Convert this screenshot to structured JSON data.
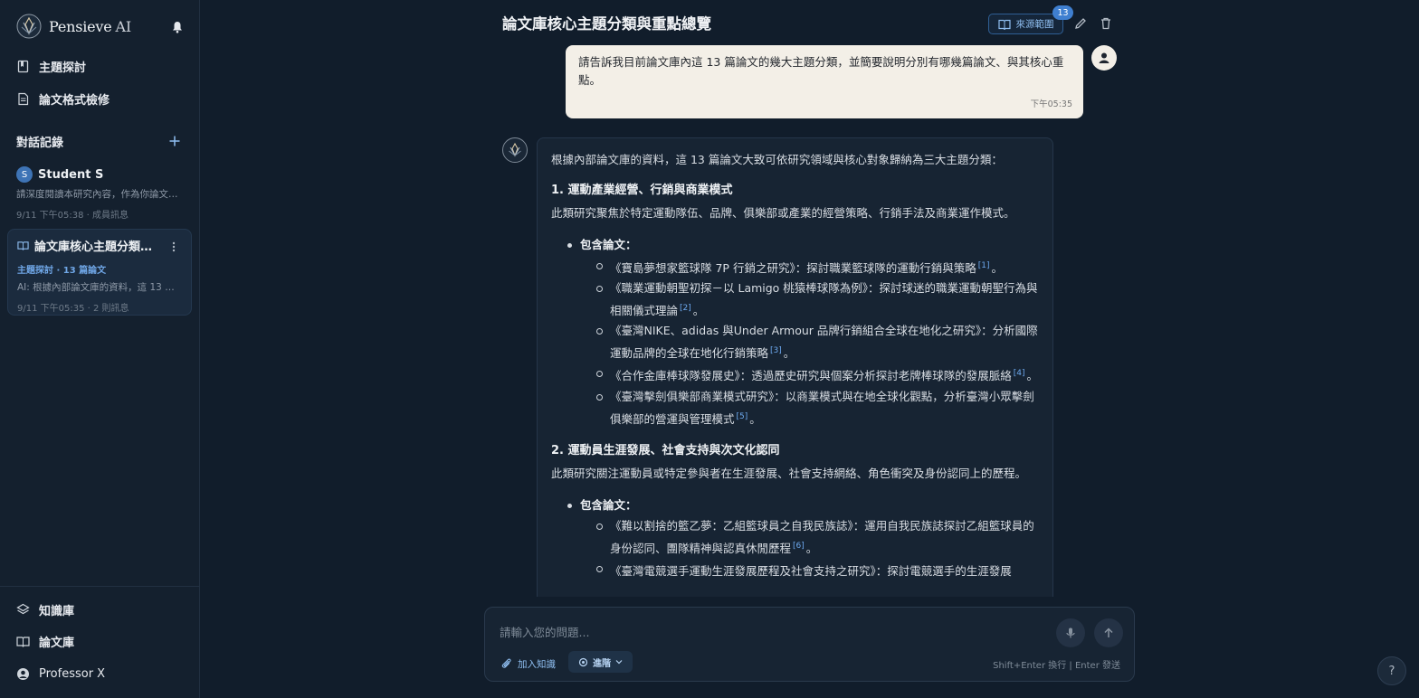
{
  "brand": {
    "name": "Pensieve",
    "suffix": "AI"
  },
  "nav": {
    "topic_explore": "主題探討",
    "format_check": "論文格式檢修",
    "knowledge_base": "知識庫",
    "paper_library": "論文庫",
    "user_name": "Professor X"
  },
  "history": {
    "title": "對話記錄",
    "items": [
      {
        "avatar_letter": "S",
        "name": "Student S",
        "preview": "請深度閱讀本研究內容，作為你論文…",
        "meta": "9/11 下午05:38 · 成員訊息"
      },
      {
        "name": "論文庫核心主題分類與重點總覽",
        "tag": "主題探討 · 13 篇論文",
        "preview": "AI: 根據內部論文庫的資料，這 13 篇…",
        "meta": "9/11 下午05:35 · 2 則訊息"
      }
    ]
  },
  "header": {
    "title": "論文庫核心主題分類與重點總覽",
    "source_label": "來源範圍",
    "source_count": "13"
  },
  "user_message": {
    "text": "請告訴我目前論文庫內這 13 篇論文的幾大主題分類，並簡要說明分別有哪幾篇論文、與其核心重點。",
    "time": "下午05:35"
  },
  "ai_message": {
    "intro": "根據內部論文庫的資料，這 13 篇論文大致可依研究領域與核心對象歸納為三大主題分類：",
    "sections": [
      {
        "heading": "1. 運動產業經營、行銷與商業模式",
        "desc": "此類研究聚焦於特定運動隊伍、品牌、俱樂部或產業的經營策略、行銷手法及商業運作模式。",
        "bullet": "包含論文：",
        "papers": [
          {
            "text": "《寶島夢想家籃球隊 7P 行銷之研究》：探討職業籃球隊的運動行銷與策略",
            "cite": "[1]",
            "end": "。"
          },
          {
            "text": "《職業運動朝聖初探－以 Lamigo 桃猿棒球隊為例》：探討球迷的職業運動朝聖行為與相關儀式理論",
            "cite": "[2]",
            "end": "。"
          },
          {
            "text": "《臺灣NIKE、adidas 與Under Armour 品牌行銷組合全球在地化之研究》：分析國際運動品牌的全球在地化行銷策略",
            "cite": "[3]",
            "end": "。"
          },
          {
            "text": "《合作金庫棒球隊發展史》：透過歷史研究與個案分析探討老牌棒球隊的發展脈絡",
            "cite": "[4]",
            "end": "。"
          },
          {
            "text": "《臺灣擊劍俱樂部商業模式研究》：以商業模式與在地全球化觀點，分析臺灣小眾擊劍俱樂部的營運與管理模式",
            "cite": "[5]",
            "end": "。"
          }
        ]
      },
      {
        "heading": "2. 運動員生涯發展、社會支持與次文化認同",
        "desc": "此類研究關注運動員或特定參與者在生涯發展、社會支持網絡、角色衝突及身份認同上的歷程。",
        "bullet": "包含論文：",
        "papers": [
          {
            "text": "《難以割捨的籃乙夢：乙組籃球員之自我民族誌》：運用自我民族誌探討乙組籃球員的身份認同、團隊精神與認真休閒歷程",
            "cite": "[6]",
            "end": "。"
          },
          {
            "text": "《臺灣電競選手運動生涯發展歷程及社會支持之研究》：探討電競選手的生涯發展",
            "cite": "",
            "end": ""
          }
        ]
      }
    ]
  },
  "composer": {
    "placeholder": "請輸入您的問題...",
    "attach_label": "加入知識",
    "advanced_label": "進階",
    "hint": "Shift+Enter 換行 | Enter 發送"
  },
  "help_label": "?"
}
